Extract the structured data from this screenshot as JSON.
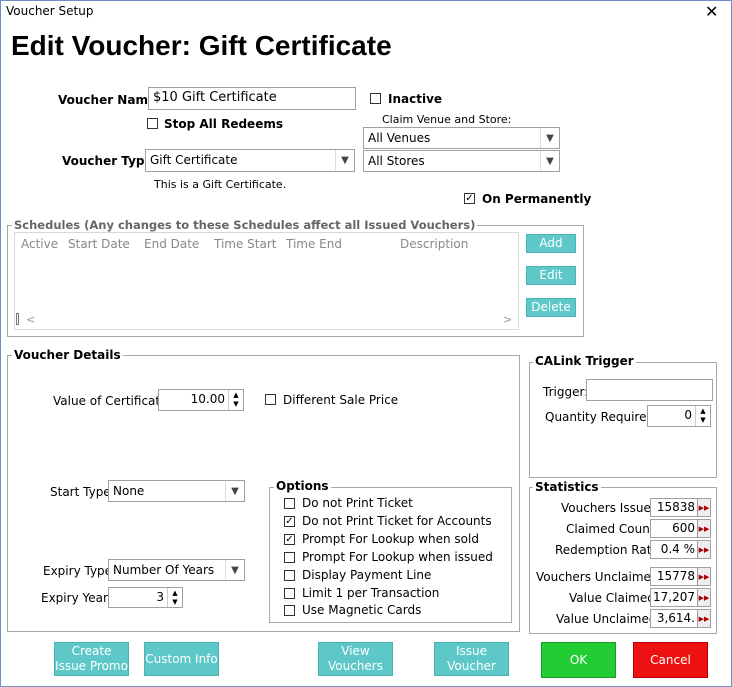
{
  "window": {
    "title": "Voucher Setup",
    "close": "✕"
  },
  "header": {
    "title": "Edit Voucher: Gift Certificate"
  },
  "voucher": {
    "name_label": "Voucher Name:",
    "name_value": "$10 Gift Certificate",
    "inactive_label": "Inactive",
    "stop_redeems_label": "Stop All Redeems",
    "claim_label": "Claim Venue and Store:",
    "venue_value": "All Venues",
    "store_value": "All Stores",
    "type_label": "Voucher Type:",
    "type_value": "Gift Certificate",
    "type_desc": "This is a Gift Certificate.",
    "on_perm_label": "On Permanently"
  },
  "schedules": {
    "legend": "Schedules (Any changes to these Schedules affect all Issued Vouchers)",
    "columns": [
      "Active",
      "Start Date",
      "End Date",
      "Time Start",
      "Time End",
      "Description"
    ],
    "add": "Add",
    "edit": "Edit",
    "delete": "Delete"
  },
  "details": {
    "legend": "Voucher Details",
    "value_label": "Value of Certificate:",
    "value": "10.00",
    "diff_sale_label": "Different Sale Price",
    "start_type_label": "Start Type:",
    "start_type_value": "None",
    "expiry_type_label": "Expiry Type:",
    "expiry_type_value": "Number Of Years",
    "expiry_years_label": "Expiry Years:",
    "expiry_years_value": "3"
  },
  "options": {
    "legend": "Options",
    "items": [
      {
        "label": "Do not Print Ticket",
        "checked": false
      },
      {
        "label": "Do not Print Ticket for Accounts",
        "checked": true
      },
      {
        "label": "Prompt For Lookup when sold",
        "checked": true
      },
      {
        "label": "Prompt For Lookup when issued",
        "checked": false
      },
      {
        "label": "Display Payment Line",
        "checked": false
      },
      {
        "label": "Limit 1 per Transaction",
        "checked": false
      },
      {
        "label": "Use Magnetic Cards",
        "checked": false
      }
    ]
  },
  "calink": {
    "legend": "CALink Trigger",
    "trigger_label": "Trigger:",
    "trigger_value": "",
    "qty_label": "Quantity Required:",
    "qty_value": "0"
  },
  "statistics": {
    "legend": "Statistics",
    "rows": [
      {
        "label": "Vouchers Issued:",
        "value": "15838"
      },
      {
        "label": "Claimed Count:",
        "value": "600"
      },
      {
        "label": "Redemption Rate:",
        "value": "0.4 %"
      },
      {
        "label": "Vouchers Unclaimed:",
        "value": "15778"
      },
      {
        "label": "Value Claimed:",
        "value": "17,207"
      },
      {
        "label": "Value Unclaimed:",
        "value": "3,614."
      }
    ]
  },
  "footer": {
    "create_issue_promo": "Create Issue Promo",
    "custom_info": "Custom Info",
    "view_vouchers": "View Vouchers",
    "issue_voucher": "Issue Voucher",
    "ok": "OK",
    "cancel": "Cancel"
  },
  "icons": {
    "chevron": "chevron-down-icon",
    "check": "checkmark-icon",
    "spin": "spinner-arrows-icon",
    "stat": "fast-forward-icon"
  }
}
